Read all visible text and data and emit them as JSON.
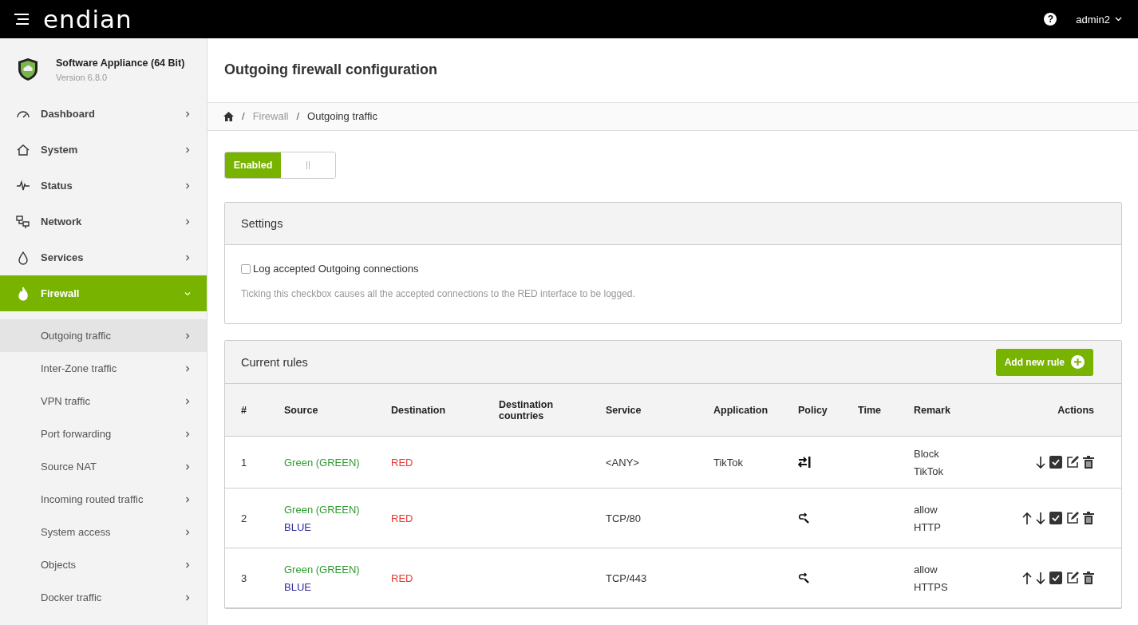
{
  "header": {
    "logo": "endian",
    "help": "?",
    "user": "admin2"
  },
  "product": {
    "name": "Software Appliance (64 Bit)",
    "version": "Version 6.8.0"
  },
  "sidebar": {
    "items": [
      {
        "label": "Dashboard",
        "kind": "gauge",
        "selected": false,
        "expanded": false
      },
      {
        "label": "System",
        "kind": "house",
        "selected": false,
        "expanded": false
      },
      {
        "label": "Status",
        "kind": "pulse",
        "selected": false,
        "expanded": false
      },
      {
        "label": "Network",
        "kind": "network",
        "selected": false,
        "expanded": false
      },
      {
        "label": "Services",
        "kind": "drop",
        "selected": false,
        "expanded": false
      },
      {
        "label": "Firewall",
        "kind": "flame",
        "selected": true,
        "expanded": true,
        "children": [
          {
            "label": "Outgoing traffic",
            "selected": true
          },
          {
            "label": "Inter-Zone traffic",
            "selected": false
          },
          {
            "label": "VPN traffic",
            "selected": false
          },
          {
            "label": "Port forwarding",
            "selected": false
          },
          {
            "label": "Source NAT",
            "selected": false
          },
          {
            "label": "Incoming routed traffic",
            "selected": false
          },
          {
            "label": "System access",
            "selected": false
          },
          {
            "label": "Objects",
            "selected": false
          },
          {
            "label": "Docker traffic",
            "selected": false
          }
        ]
      }
    ]
  },
  "page": {
    "title": "Outgoing firewall configuration"
  },
  "breadcrumb": [
    {
      "separator": "/",
      "label": "Firewall"
    },
    {
      "separator": "/",
      "label": "Outgoing traffic"
    }
  ],
  "toggle": {
    "label": "Enabled",
    "on": true
  },
  "settings": {
    "title": "Settings",
    "checkbox": {
      "label": "Log accepted Outgoing connections",
      "checked": false
    },
    "help": "Ticking this checkbox causes all the accepted connections to the RED interface to be logged."
  },
  "rules": {
    "title": "Current rules",
    "add_button": "Add new rule",
    "columns": [
      "#",
      "Source",
      "Destination",
      "Destination countries",
      "Service",
      "Application",
      "Policy",
      "Time",
      "Remark",
      "Actions"
    ],
    "rows": [
      {
        "number": "1",
        "source": [
          {
            "name": "Green (GREEN)",
            "color": "#2e9b2e"
          }
        ],
        "destination": [
          {
            "name": "RED",
            "color": "#e8382f"
          }
        ],
        "service": "<ANY>",
        "application": "TikTok",
        "policy": {
          "kind": "block"
        },
        "remark": [
          "Block",
          "TikTok"
        ],
        "actions": [
          {
            "kind": "down"
          },
          {
            "kind": "enable"
          },
          {
            "kind": "edit"
          },
          {
            "kind": "delete"
          }
        ]
      },
      {
        "number": "2",
        "source": [
          {
            "name": "Green (GREEN)",
            "color": "#2e9b2e"
          },
          {
            "name": "BLUE",
            "color": "#302e9b"
          }
        ],
        "destination": [
          {
            "name": "RED",
            "color": "#e8382f"
          }
        ],
        "service": "TCP/80",
        "policy": {
          "kind": "allow"
        },
        "remark": [
          "allow",
          "HTTP"
        ],
        "actions": [
          {
            "kind": "up"
          },
          {
            "kind": "down"
          },
          {
            "kind": "enable"
          },
          {
            "kind": "edit"
          },
          {
            "kind": "delete"
          }
        ]
      },
      {
        "number": "3",
        "source": [
          {
            "name": "Green (GREEN)",
            "color": "#2e9b2e"
          },
          {
            "name": "BLUE",
            "color": "#302e9b"
          }
        ],
        "destination": [
          {
            "name": "RED",
            "color": "#e8382f"
          }
        ],
        "service": "TCP/443",
        "policy": {
          "kind": "allow"
        },
        "remark": [
          "allow",
          "HTTPS"
        ],
        "actions": [
          {
            "kind": "up"
          },
          {
            "kind": "down"
          },
          {
            "kind": "enable"
          },
          {
            "kind": "edit"
          },
          {
            "kind": "delete"
          }
        ]
      }
    ]
  }
}
